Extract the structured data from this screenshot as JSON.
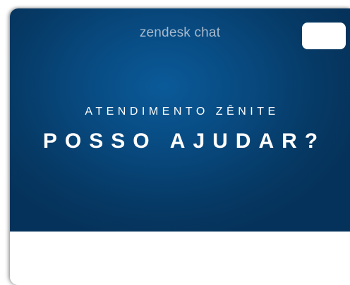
{
  "widget": {
    "brand": "zendesk chat",
    "banner": {
      "subtitle": "ATENDIMENTO ZÊNITE",
      "headline": "POSSO AJUDAR?"
    },
    "colors": {
      "banner_center": "#0a5a99",
      "banner_edge": "#05325a",
      "brand_text": "#a7b9cc",
      "text": "#ffffff"
    }
  }
}
